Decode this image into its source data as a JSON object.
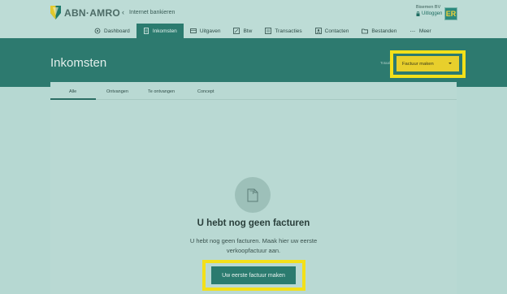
{
  "app": {
    "brand": "ABN·AMRO",
    "back_link": "Internet bankieren",
    "company": "Bisemen BV",
    "logout": "Uitloggen",
    "avatar_initials": "ER"
  },
  "nav": {
    "items": [
      {
        "label": "Dashboard",
        "icon": "dashboard-icon"
      },
      {
        "label": "Inkomsten",
        "icon": "invoice-icon",
        "active": true
      },
      {
        "label": "Uitgaven",
        "icon": "receipt-icon"
      },
      {
        "label": "Btw",
        "icon": "percent-icon"
      },
      {
        "label": "Transacties",
        "icon": "transactions-icon"
      },
      {
        "label": "Contacten",
        "icon": "contacts-icon"
      },
      {
        "label": "Bestanden",
        "icon": "folder-icon"
      },
      {
        "label": "Meer",
        "icon": "more-icon"
      }
    ]
  },
  "page": {
    "title": "Inkomsten",
    "total_label": "Totaal",
    "factuur_button": "Factuur maken"
  },
  "tabs": [
    "Alle",
    "Ontvangen",
    "Te ontvangen",
    "Concept"
  ],
  "empty_state": {
    "title": "U hebt nog geen facturen",
    "description": "U hebt nog geen facturen. Maak hier uw eerste verkoopfactuur aan.",
    "button": "Uw eerste factuur maken"
  },
  "colors": {
    "brand_green": "#2d7a6f",
    "highlight_yellow": "#f3e01a",
    "button_yellow": "#e8cf2c"
  }
}
